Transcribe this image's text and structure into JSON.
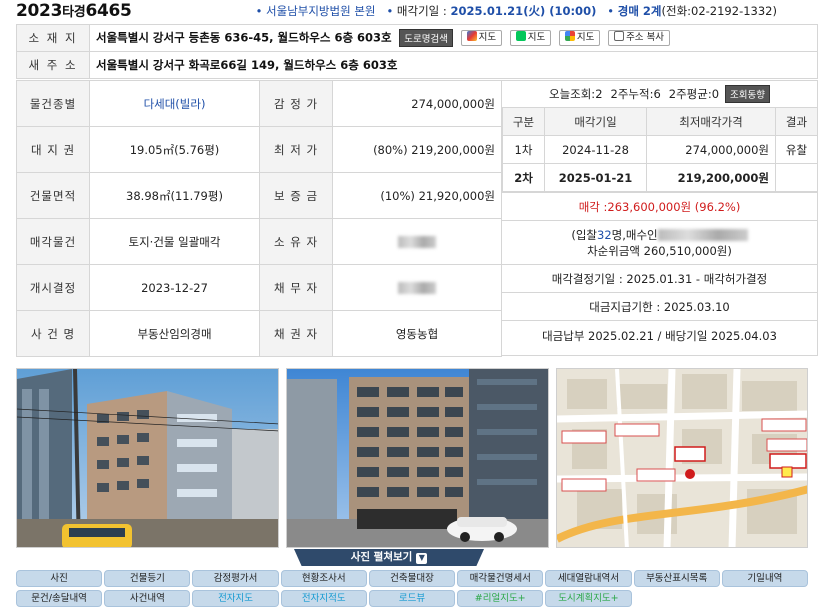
{
  "header": {
    "case_year": "2023",
    "case_type": "타경",
    "case_num": "6465",
    "court": "서울남부지방법원 본원",
    "sale_date_label": "매각기일 : ",
    "sale_date": "2025.01.21(火) (10:00)",
    "dept": "경매 2계",
    "phone": "(전화:02-2192-1332)"
  },
  "address": {
    "location_label": "소 재 지",
    "location": "서울특별시 강서구 등촌동 636-45, 월드하우스 6층 603호",
    "road_search_btn": "도로명검색",
    "map_btn_daum": "지도",
    "map_btn_naver": "지도",
    "map_btn_google": "지도",
    "copy_btn": "주소 복사",
    "new_addr_label": "새 주 소",
    "new_addr": "서울특별시 강서구 화곡로66길 149, 월드하우스 6층 603호"
  },
  "details": [
    {
      "label": "물건종별",
      "value": "다세대(빌라)",
      "label2": "감 정 가",
      "value2": "274,000,000원"
    },
    {
      "label": "대 지 권",
      "value": "19.05㎡(5.76평)",
      "label2": "최 저 가",
      "value2": "(80%) 219,200,000원"
    },
    {
      "label": "건물면적",
      "value": "38.98㎡(11.79평)",
      "label2": "보 증 금",
      "value2": "(10%) 21,920,000원"
    },
    {
      "label": "매각물건",
      "value": "토지·건물 일괄매각",
      "label2": "소 유 자",
      "value2": ""
    },
    {
      "label": "개시결정",
      "value": "2023-12-27",
      "label2": "채 무 자",
      "value2": ""
    },
    {
      "label": "사 건 명",
      "value": "부동산임의경매",
      "label2": "채 권 자",
      "value2": "영동농협"
    }
  ],
  "views": {
    "today_label": "오늘조회: ",
    "today": "2",
    "week2_label": "2주누적: ",
    "week2": "6",
    "avg_label": "2주평균: ",
    "avg": "0",
    "trend_btn": "조회동향"
  },
  "history": {
    "headers": [
      "구분",
      "매각기일",
      "최저매각가격",
      "결과"
    ],
    "rows": [
      {
        "round": "1차",
        "date": "2024-11-28",
        "price": "274,000,000원",
        "result": "유찰"
      },
      {
        "round": "2차",
        "date": "2025-01-21",
        "price": "219,200,000원",
        "result": ""
      }
    ]
  },
  "result": {
    "sold_label": "매각 : ",
    "sold_price": "263,600,000원",
    "sold_pct": "(96.2%)",
    "bid_prefix": "(입찰",
    "bid_count": "32",
    "bid_suffix": "명,매수인",
    "second_bid": "차순위금액 260,510,000원)",
    "decision": "매각결정기일 : 2025.01.31 - 매각허가결정",
    "deadline": "대금지급기한 : 2025.03.10",
    "payment": "대금납부 2025.02.21 / 배당기일 2025.04.03"
  },
  "gallery_btn": "사진 펼쳐보기",
  "tabs": [
    {
      "label": "사진",
      "color": "default"
    },
    {
      "label": "건물등기",
      "color": "default"
    },
    {
      "label": "감정평가서",
      "color": "default"
    },
    {
      "label": "현황조사서",
      "color": "default"
    },
    {
      "label": "건축물대장",
      "color": "default"
    },
    {
      "label": "매각물건명세서",
      "color": "default"
    },
    {
      "label": "세대열람내역서",
      "color": "default"
    },
    {
      "label": "부동산표시목록",
      "color": "default"
    },
    {
      "label": "기일내역",
      "color": "default"
    },
    {
      "label": "문건/송달내역",
      "color": "default"
    },
    {
      "label": "사건내역",
      "color": "default"
    },
    {
      "label": "전자지도",
      "color": "cyan"
    },
    {
      "label": "전자지적도",
      "color": "cyan"
    },
    {
      "label": "로드뷰",
      "color": "cyan"
    },
    {
      "label": "#리얼지도+",
      "color": "green"
    },
    {
      "label": "도시계획지도+",
      "color": "green"
    }
  ]
}
